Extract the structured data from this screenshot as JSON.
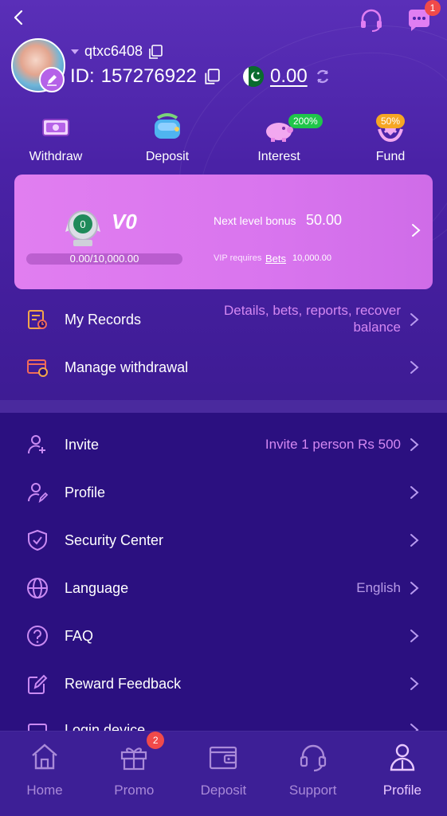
{
  "header": {
    "username": "qtxc6408",
    "id_label": "ID:",
    "id_value": "157276922",
    "balance": "0.00",
    "message_badge": "1"
  },
  "quick_actions": [
    {
      "label": "Withdraw",
      "icon": "withdraw-icon",
      "badge": ""
    },
    {
      "label": "Deposit",
      "icon": "deposit-icon",
      "badge": ""
    },
    {
      "label": "Interest",
      "icon": "interest-icon",
      "badge": "200%"
    },
    {
      "label": "Fund",
      "icon": "fund-icon",
      "badge": "50%"
    }
  ],
  "vip": {
    "medal_level": "0",
    "level": "V0",
    "next_level_label": "Next level bonus",
    "next_level_value": "50.00",
    "progress_text": "0.00/10,000.00",
    "progress_fraction": 0,
    "requires_label": "VIP requires",
    "bets_label": "Bets",
    "requires_value": "10,000.00"
  },
  "menu_top": [
    {
      "label": "My Records",
      "hint": "Details, bets, reports, recover balance",
      "icon": "records-icon"
    },
    {
      "label": "Manage withdrawal",
      "hint": "",
      "icon": "withdrawal-card-icon"
    }
  ],
  "menu_bottom": [
    {
      "label": "Invite",
      "hint": "Invite 1 person Rs 500",
      "icon": "invite-icon"
    },
    {
      "label": "Profile",
      "hint": "",
      "icon": "profile-edit-icon"
    },
    {
      "label": "Security Center",
      "hint": "",
      "icon": "shield-icon"
    },
    {
      "label": "Language",
      "hint": "English",
      "icon": "globe-icon"
    },
    {
      "label": "FAQ",
      "hint": "",
      "icon": "question-icon"
    },
    {
      "label": "Reward Feedback",
      "hint": "",
      "icon": "feedback-icon"
    },
    {
      "label": "Login device",
      "hint": "",
      "icon": "device-icon"
    }
  ],
  "tabbar": [
    {
      "label": "Home",
      "icon": "home-icon",
      "badge": ""
    },
    {
      "label": "Promo",
      "icon": "gift-icon",
      "badge": "2"
    },
    {
      "label": "Deposit",
      "icon": "wallet-icon",
      "badge": ""
    },
    {
      "label": "Support",
      "icon": "headset-icon",
      "badge": ""
    },
    {
      "label": "Profile",
      "icon": "user-icon",
      "badge": ""
    }
  ],
  "colors": {
    "background": "#2a0f7a",
    "header": "#4a22a6",
    "vip_card": "#dc78ee",
    "accent": "#d488f2",
    "badge_red": "#f04a4a",
    "badge_green": "#1fc64a",
    "badge_orange": "#f6a623"
  }
}
